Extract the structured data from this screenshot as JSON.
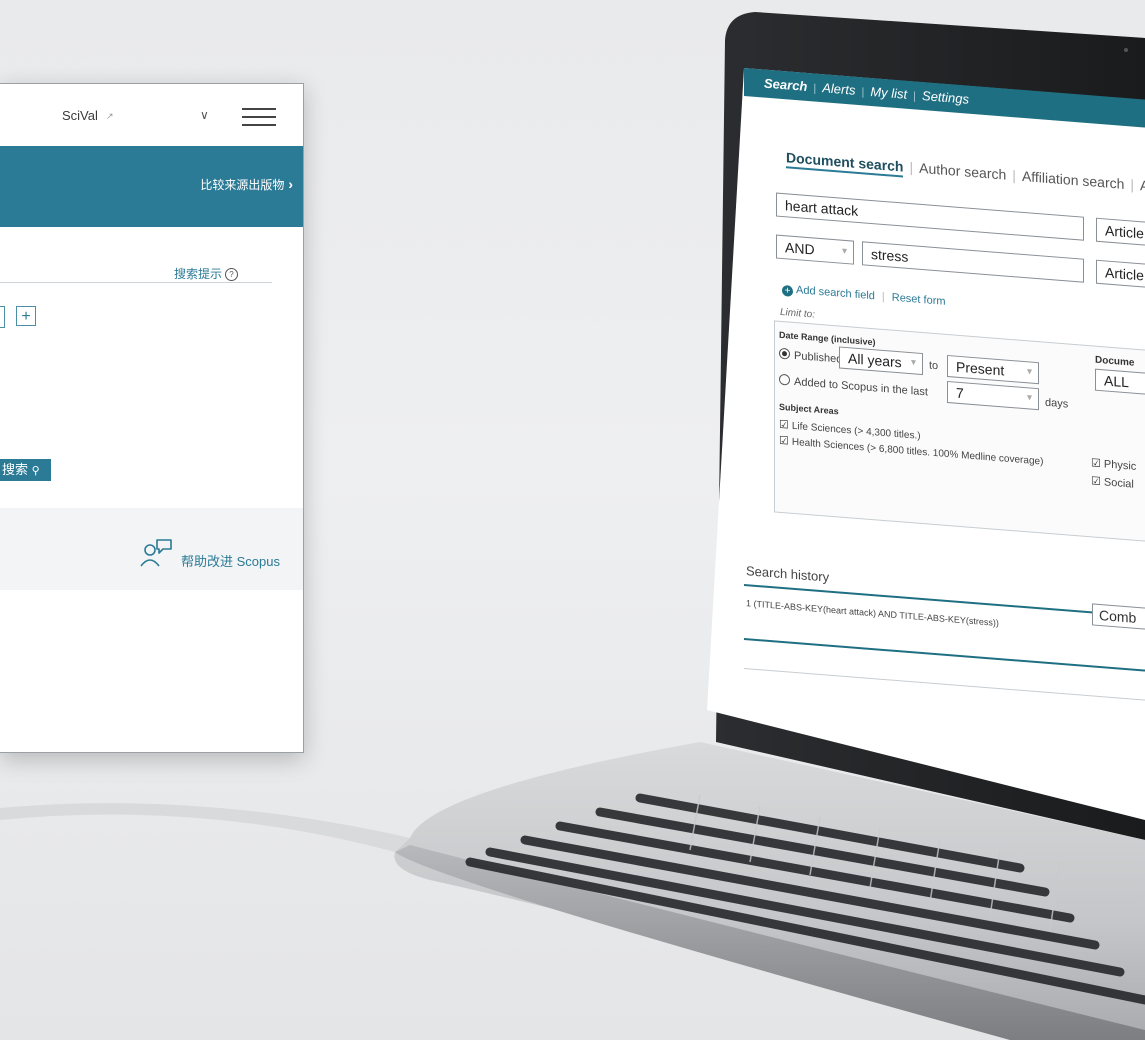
{
  "panel": {
    "scival": "SciVal",
    "scival_ext": "↗",
    "banner_link": "比较来源出版物",
    "banner_arrow": "›",
    "search_tips": "搜索提示",
    "tips_icon": "?",
    "plus": "+",
    "search_button": "搜索",
    "search_icon": "⚲",
    "help_text": "帮助改进 Scopus",
    "chevron": "∨"
  },
  "screen": {
    "nav": {
      "search": "Search",
      "alerts": "Alerts",
      "mylist": "My list",
      "settings": "Settings",
      "sep": "|"
    },
    "tabs": {
      "document": "Document search",
      "author": "Author search",
      "affiliation": "Affiliation search",
      "advanced": "Ad",
      "sep": "|"
    },
    "field1_value": "heart attack",
    "field1_type": "Article T",
    "operator": "AND",
    "field2_value": "stress",
    "field2_type": "Article T",
    "add_field": "Add search field",
    "reset": "Reset form",
    "limit_to": "Limit to:",
    "date_range_label": "Date Range (inclusive)",
    "published": "Published",
    "from_year": "All years",
    "to": "to",
    "to_year": "Present",
    "added_to_scopus": "Added to Scopus in the last",
    "days_value": "7",
    "days": "days",
    "document_label": "Docume",
    "document_value": "ALL",
    "subject_areas": "Subject Areas",
    "life_sciences": "Life Sciences (> 4,300 titles.)",
    "health_sciences": "Health Sciences (> 6,800 titles. 100% Medline coverage)",
    "physical": "Physic",
    "social": "Social",
    "history_title": "Search history",
    "history_row": "1 (TITLE-ABS-KEY(heart attack) AND TITLE-ABS-KEY(stress))",
    "combine": "Comb"
  },
  "colors": {
    "teal": "#2b7a96",
    "nav": "#1f6f83"
  }
}
